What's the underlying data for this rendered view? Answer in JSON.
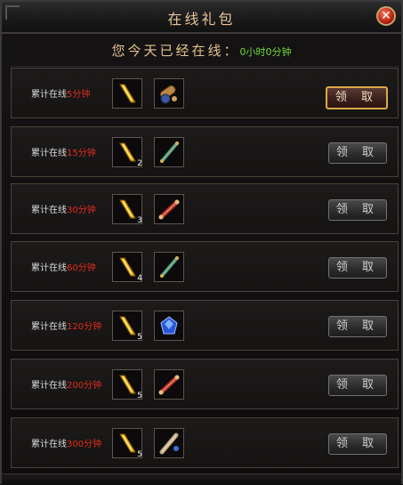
{
  "window": {
    "title": "在线礼包"
  },
  "online": {
    "label": "您今天已经在线：",
    "value": "0小时0分钟"
  },
  "rows": [
    {
      "prefix": "累计在线",
      "mins": "5分钟",
      "qty1": "",
      "item2": "cannon",
      "button": "领 取",
      "active": true
    },
    {
      "prefix": "累计在线",
      "mins": "15分钟",
      "qty1": "2",
      "item2": "teal-scroll",
      "button": "领 取",
      "active": false
    },
    {
      "prefix": "累计在线",
      "mins": "30分钟",
      "qty1": "3",
      "item2": "red-scroll",
      "button": "领 取",
      "active": false
    },
    {
      "prefix": "累计在线",
      "mins": "60分钟",
      "qty1": "4",
      "item2": "teal-scroll",
      "button": "领 取",
      "active": false
    },
    {
      "prefix": "累计在线",
      "mins": "120分钟",
      "qty1": "5",
      "item2": "blue-gem",
      "button": "领 取",
      "active": false
    },
    {
      "prefix": "累计在线",
      "mins": "200分钟",
      "qty1": "5",
      "item2": "red-scroll",
      "button": "领 取",
      "active": false
    },
    {
      "prefix": "累计在线",
      "mins": "300分钟",
      "qty1": "5",
      "item2": "blue-scroll",
      "button": "领 取",
      "active": false
    }
  ]
}
